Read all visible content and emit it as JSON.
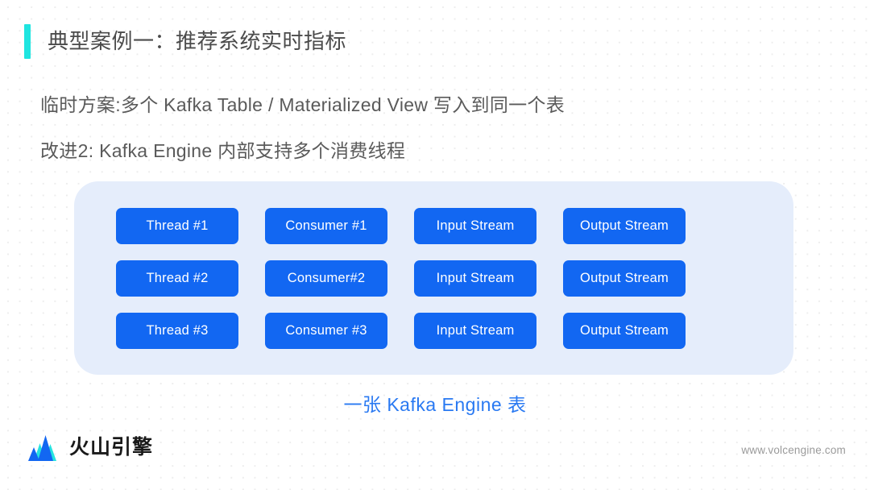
{
  "slide": {
    "title": "典型案例一：推荐系统实时指标",
    "accent_color": "#1FE5E0",
    "body_lines": [
      "临时方案:多个 Kafka Table / Materialized View 写入到同一个表",
      "改进2: Kafka Engine 内部支持多个消费线程"
    ],
    "caption": "一张 Kafka Engine 表",
    "caption_color": "#2979F2"
  },
  "diagram": {
    "panel_color": "#E5EDFB",
    "node_color": "#1267F2",
    "node_text_color": "#FFFFFF",
    "rows": [
      {
        "nodes": [
          {
            "label": "Thread #1"
          },
          {
            "label": "Consumer #1"
          },
          {
            "label": "Input Stream"
          },
          {
            "label": "Output Stream"
          }
        ]
      },
      {
        "nodes": [
          {
            "label": "Thread #2"
          },
          {
            "label": "Consumer#2"
          },
          {
            "label": "Input Stream"
          },
          {
            "label": "Output Stream"
          }
        ]
      },
      {
        "nodes": [
          {
            "label": "Thread #3"
          },
          {
            "label": "Consumer #3"
          },
          {
            "label": "Input Stream"
          },
          {
            "label": "Output Stream"
          }
        ]
      }
    ]
  },
  "footer": {
    "brand_name": "火山引擎",
    "url": "www.volcengine.com",
    "logo_colors": {
      "peak_blue": "#1267F2",
      "peak_cyan": "#25E3E0"
    }
  }
}
